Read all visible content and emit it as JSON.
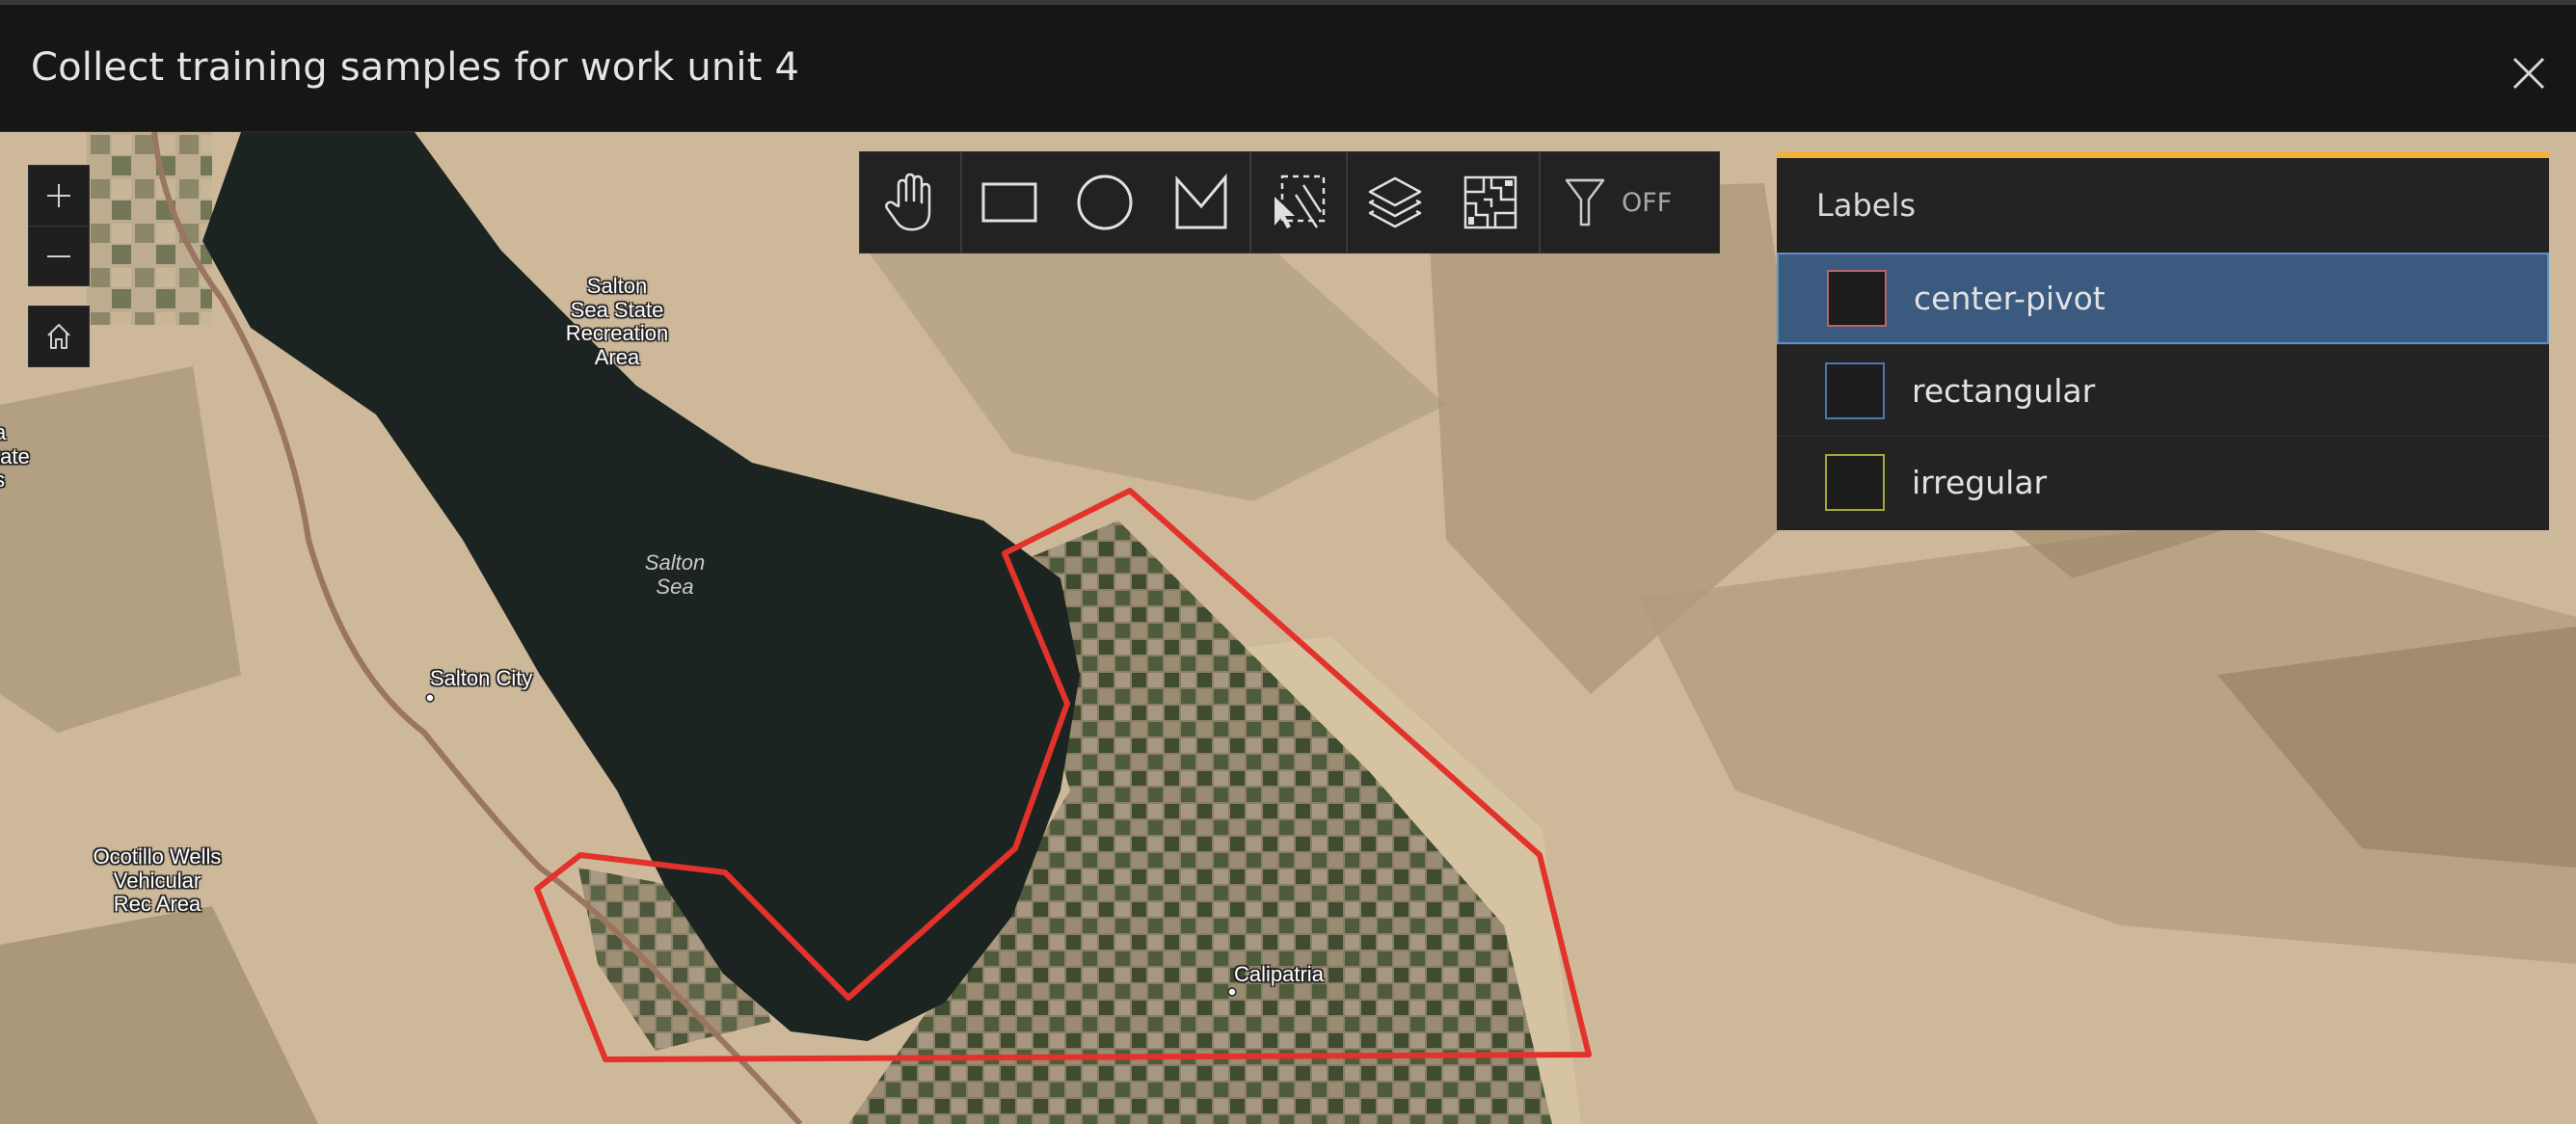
{
  "dialog": {
    "title": "Collect training samples for work unit 4",
    "close_icon": "close-icon"
  },
  "map": {
    "zoom_in_icon": "plus-icon",
    "zoom_out_icon": "minus-icon",
    "home_icon": "home-icon",
    "places": {
      "salton_sea_sra": "Salton Sea State Recreation Area",
      "salton_sea_sra_lines": [
        "Salton",
        "Sea State",
        "Recreation",
        "Area"
      ],
      "salton_city": "Salton City",
      "calipatria": "Calipatria",
      "ocotillo_lines": [
        "Ocotillo Wells",
        "Vehicular",
        "Rec Area"
      ],
      "partial_left_lines": [
        "a",
        "tate",
        "s"
      ],
      "water_lines": [
        "Salton",
        "Sea"
      ]
    },
    "sample_polygon_color": "#e3322b"
  },
  "toolbar": {
    "tools": [
      {
        "name": "pan",
        "icon": "hand-icon"
      },
      {
        "name": "rectangle",
        "icon": "rectangle-icon"
      },
      {
        "name": "circle",
        "icon": "circle-icon"
      },
      {
        "name": "polygon",
        "icon": "polygon-icon"
      },
      {
        "name": "select",
        "icon": "select-icon"
      },
      {
        "name": "layers",
        "icon": "layers-icon"
      },
      {
        "name": "segment",
        "icon": "segment-icon"
      },
      {
        "name": "filter",
        "icon": "filter-icon"
      }
    ],
    "filter_state": "OFF"
  },
  "labels_panel": {
    "header": "Labels",
    "accent_color": "#f2b33d",
    "items": [
      {
        "label": "center-pivot",
        "color": "#b8646e",
        "selected": true
      },
      {
        "label": "rectangular",
        "color": "#4a78b0",
        "selected": false
      },
      {
        "label": "irregular",
        "color": "#a6a63e",
        "selected": false
      }
    ]
  }
}
